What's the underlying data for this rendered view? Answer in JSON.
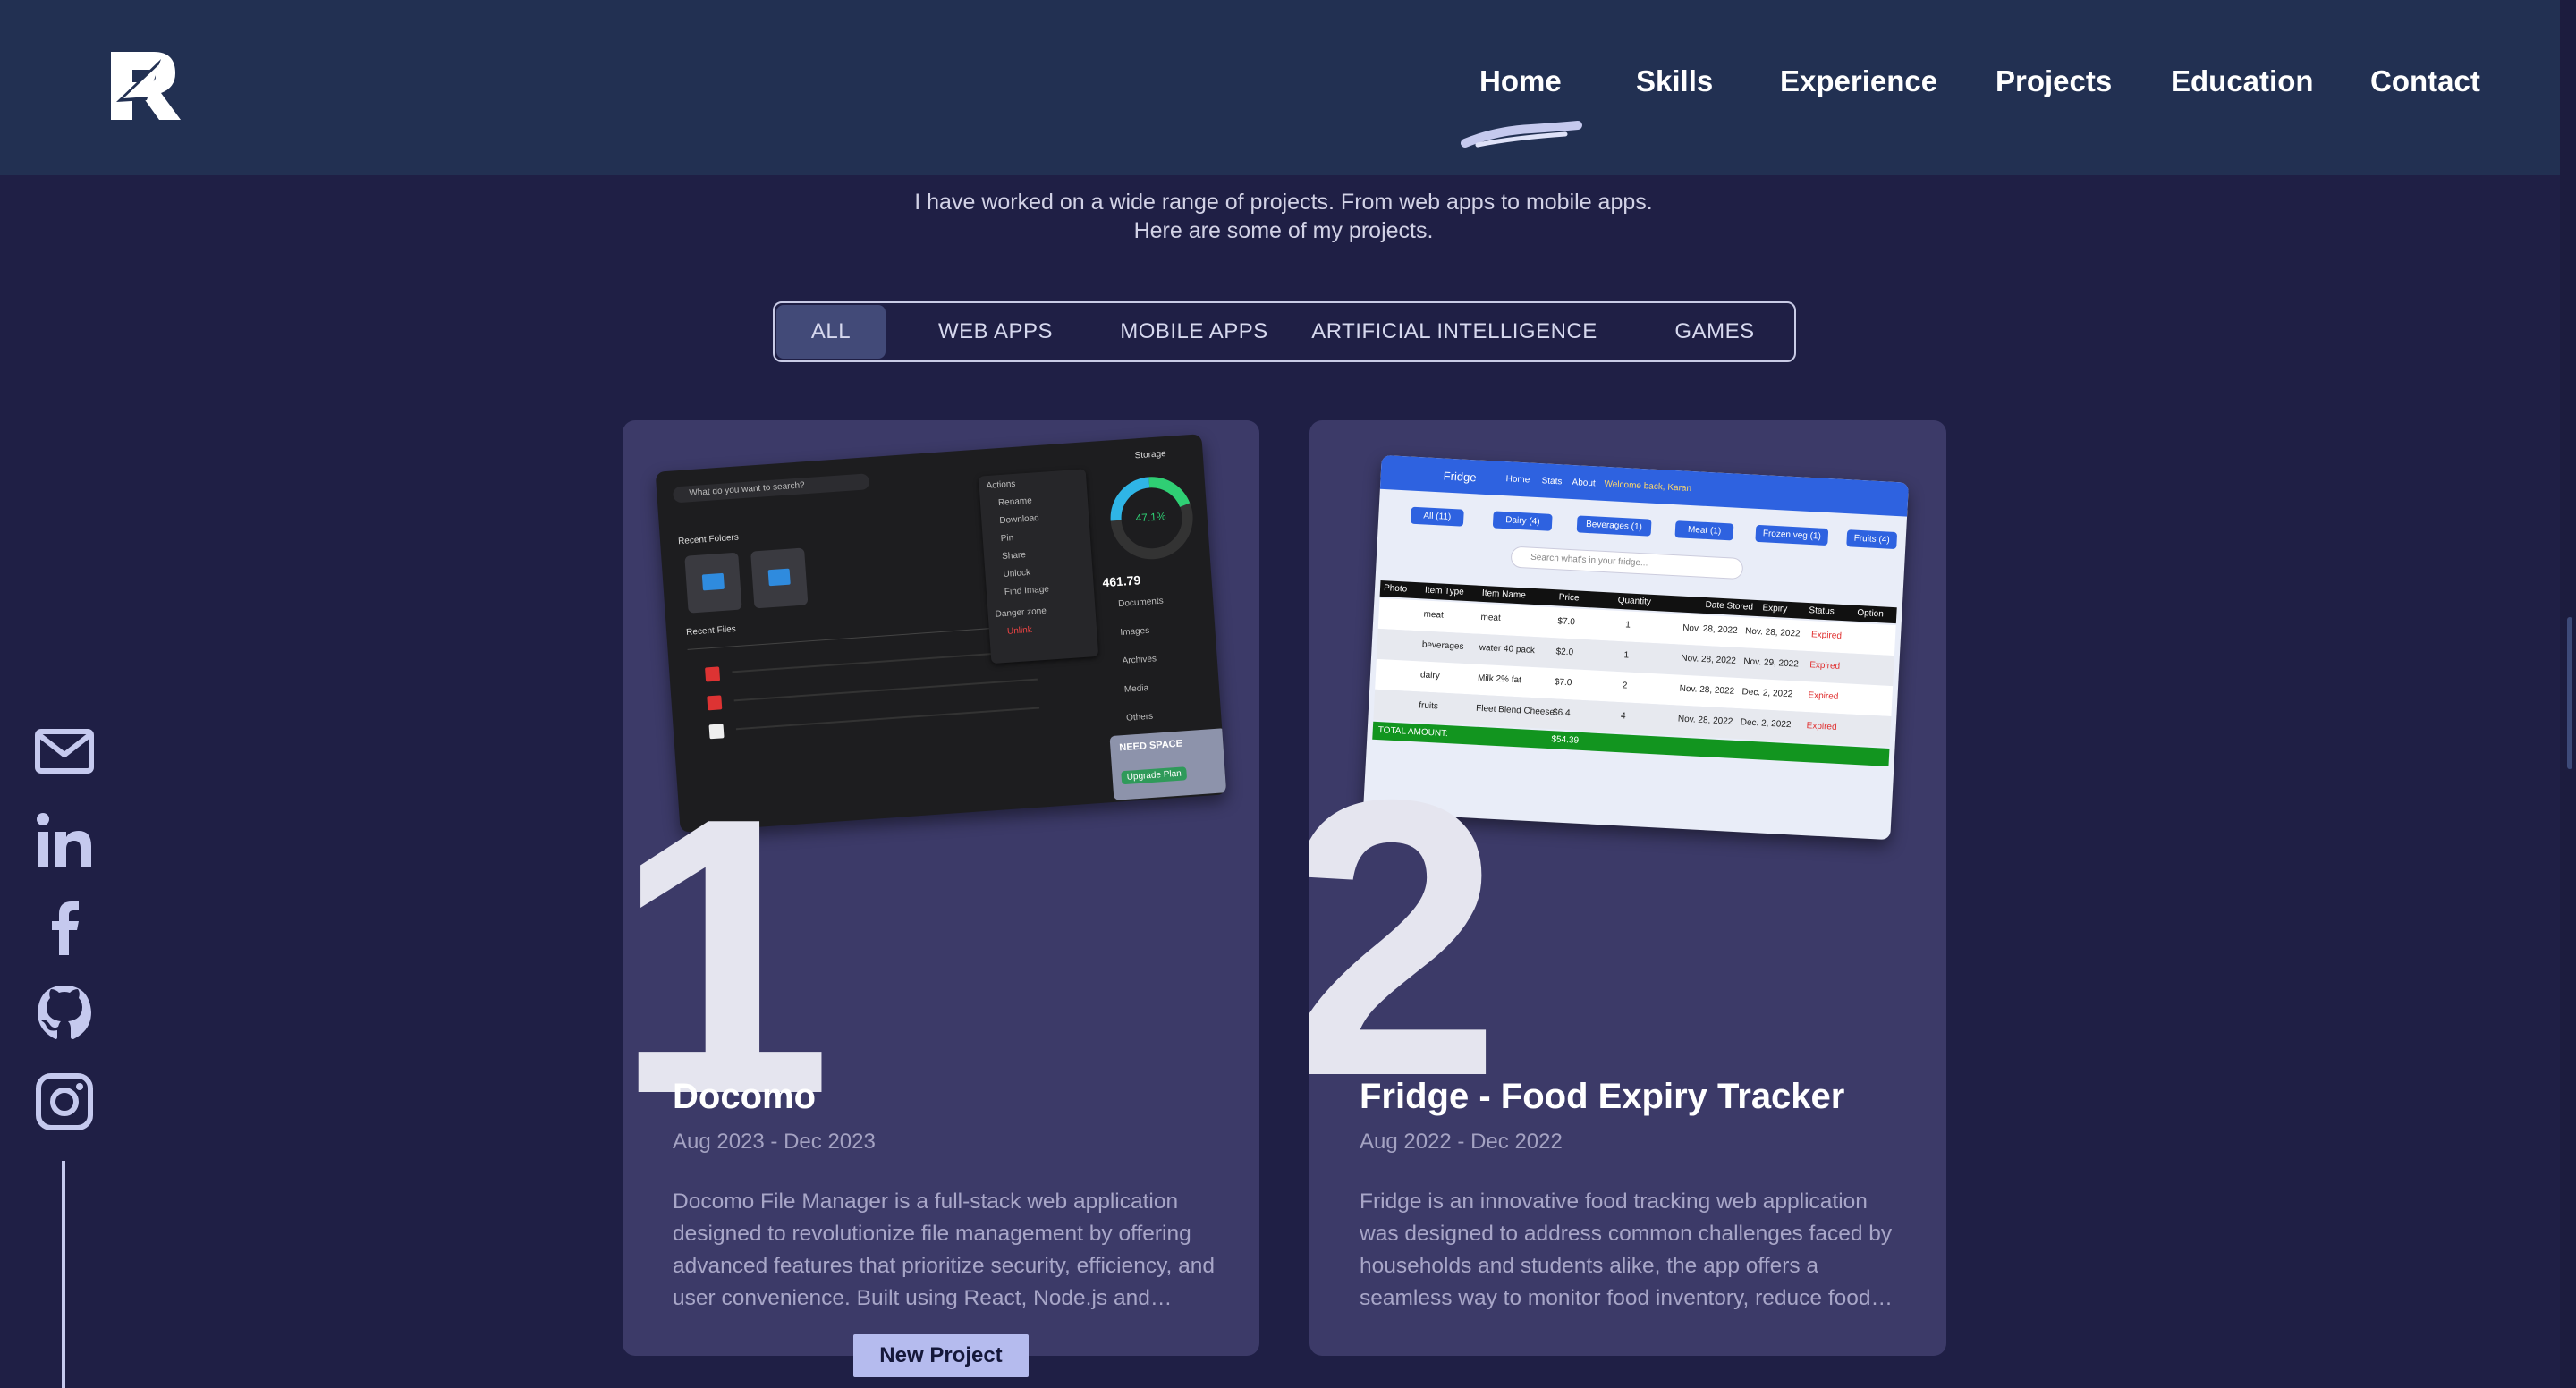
{
  "header": {
    "logo_alt": "RA monogram logo",
    "nav": [
      "Home",
      "Skills",
      "Experience",
      "Projects",
      "Education",
      "Contact"
    ],
    "active_nav": "Home"
  },
  "intro": {
    "line1": "I have worked on a wide range of projects. From web apps to mobile apps.",
    "line2": "Here are some of my projects."
  },
  "filters": {
    "tabs": [
      "ALL",
      "WEB APPS",
      "MOBILE APPS",
      "ARTIFICIAL INTELLIGENCE",
      "GAMES"
    ],
    "active": "ALL"
  },
  "social": [
    "mail-icon",
    "linkedin-icon",
    "facebook-icon",
    "github-icon",
    "instagram-icon"
  ],
  "projects": [
    {
      "number": "1",
      "title": "Docomo",
      "date": "Aug 2023 - Dec 2023",
      "description": "Docomo File Manager is a full-stack web application designed to revolutionize file management by offering advanced features that prioritize security, efficiency, and user convenience. Built using React, Node.js and MongoDB.",
      "shot": {
        "search_placeholder": "What do you want to search?",
        "storage_label": "Storage",
        "storage_percent": "47.1%",
        "storage_used": "461.79",
        "recent_folders": "Recent Folders",
        "recent_files": "Recent Files",
        "need_space": "NEED SPACE",
        "upgrade": "Upgrade Plan",
        "categories": [
          "Documents",
          "Images",
          "Archives",
          "Media",
          "Others"
        ],
        "menu": [
          "Actions",
          "Rename",
          "Download",
          "Pin",
          "Share",
          "Unlock",
          "Find Image",
          "Danger zone",
          "Unlink"
        ]
      }
    },
    {
      "number": "2",
      "title": "Fridge - Food Expiry Tracker",
      "date": "Aug 2022 - Dec 2022",
      "description": "Fridge is an innovative food tracking web application was designed to address common challenges faced by households and students alike, the app offers a seamless way to monitor food inventory, reduce food waste and save money.",
      "shot": {
        "app_name": "Fridge",
        "nav": [
          "Home",
          "Stats",
          "About"
        ],
        "welcome": "Welcome back, Karan",
        "chips": [
          "All (11)",
          "Dairy (4)",
          "Beverages (1)",
          "Meat (1)",
          "Frozen veg (1)",
          "Fruits (4)"
        ],
        "search_placeholder": "Search what's in your fridge...",
        "columns": [
          "Photo",
          "Item Type",
          "Item Name",
          "Price",
          "Quantity",
          "Date Stored",
          "Expiry",
          "Status",
          "Option"
        ],
        "rows": [
          [
            "meat",
            "meat",
            "$7.0",
            "1",
            "Nov. 28, 2022",
            "Nov. 28, 2022",
            "Expired"
          ],
          [
            "beverages",
            "water 40 pack",
            "$2.0",
            "1",
            "Nov. 28, 2022",
            "Nov. 29, 2022",
            "Expired"
          ],
          [
            "dairy",
            "Milk 2% fat",
            "$7.0",
            "2",
            "Nov. 28, 2022",
            "Dec. 2, 2022",
            "Expired"
          ],
          [
            "fruits",
            "Fleet Blend Cheese",
            "$6.4",
            "4",
            "Nov. 28, 2022",
            "Dec. 2, 2022",
            "Expired"
          ]
        ],
        "total_label": "TOTAL AMOUNT:",
        "total_value": "$54.39"
      }
    }
  ],
  "badge": "New Project",
  "colors": {
    "background": "#1f1f45",
    "header": "#223052",
    "card": "#3c3a68",
    "accent": "#b5bbee"
  }
}
